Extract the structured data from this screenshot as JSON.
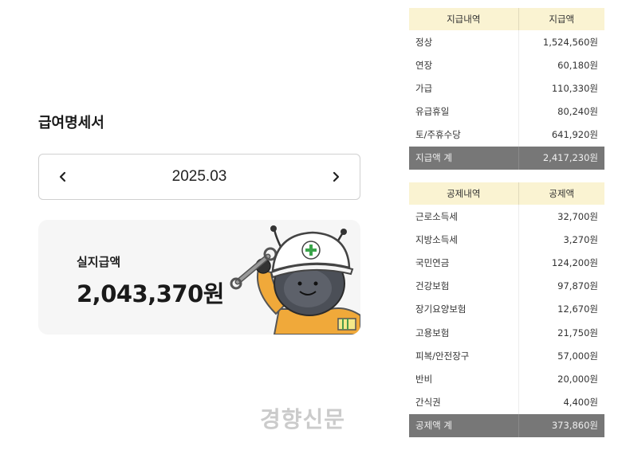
{
  "page": {
    "title": "급여명세서",
    "month": "2025.03",
    "watermark": "경향신문"
  },
  "net_pay": {
    "label": "실지급액",
    "amount": "2,043,370원"
  },
  "icons": {
    "prev": "chevron-left-icon",
    "next": "chevron-right-icon",
    "mascot": "worker-mascot-illustration"
  },
  "colors": {
    "header_bg": "#faf3d2",
    "total_bg": "#777777",
    "card_bg": "#f6f6f6"
  },
  "payments": {
    "headers": [
      "지급내역",
      "지급액"
    ],
    "rows": [
      {
        "label": "정상",
        "value": "1,524,560원"
      },
      {
        "label": "연장",
        "value": "60,180원"
      },
      {
        "label": "가급",
        "value": "110,330원"
      },
      {
        "label": "유급휴일",
        "value": "80,240원"
      },
      {
        "label": "토/주휴수당",
        "value": "641,920원"
      }
    ],
    "total": {
      "label": "지급액 계",
      "value": "2,417,230원"
    }
  },
  "deductions": {
    "headers": [
      "공제내역",
      "공제액"
    ],
    "rows": [
      {
        "label": "근로소득세",
        "value": "32,700원"
      },
      {
        "label": "지방소득세",
        "value": "3,270원"
      },
      {
        "label": "국민연금",
        "value": "124,200원"
      },
      {
        "label": "건강보험",
        "value": "97,870원"
      },
      {
        "label": "장기요양보험",
        "value": "12,670원"
      },
      {
        "label": "고용보험",
        "value": "21,750원"
      },
      {
        "label": "피복/안전장구",
        "value": "57,000원"
      },
      {
        "label": "반비",
        "value": "20,000원"
      },
      {
        "label": "간식권",
        "value": "4,400원"
      }
    ],
    "total": {
      "label": "공제액 계",
      "value": "373,860원"
    }
  }
}
